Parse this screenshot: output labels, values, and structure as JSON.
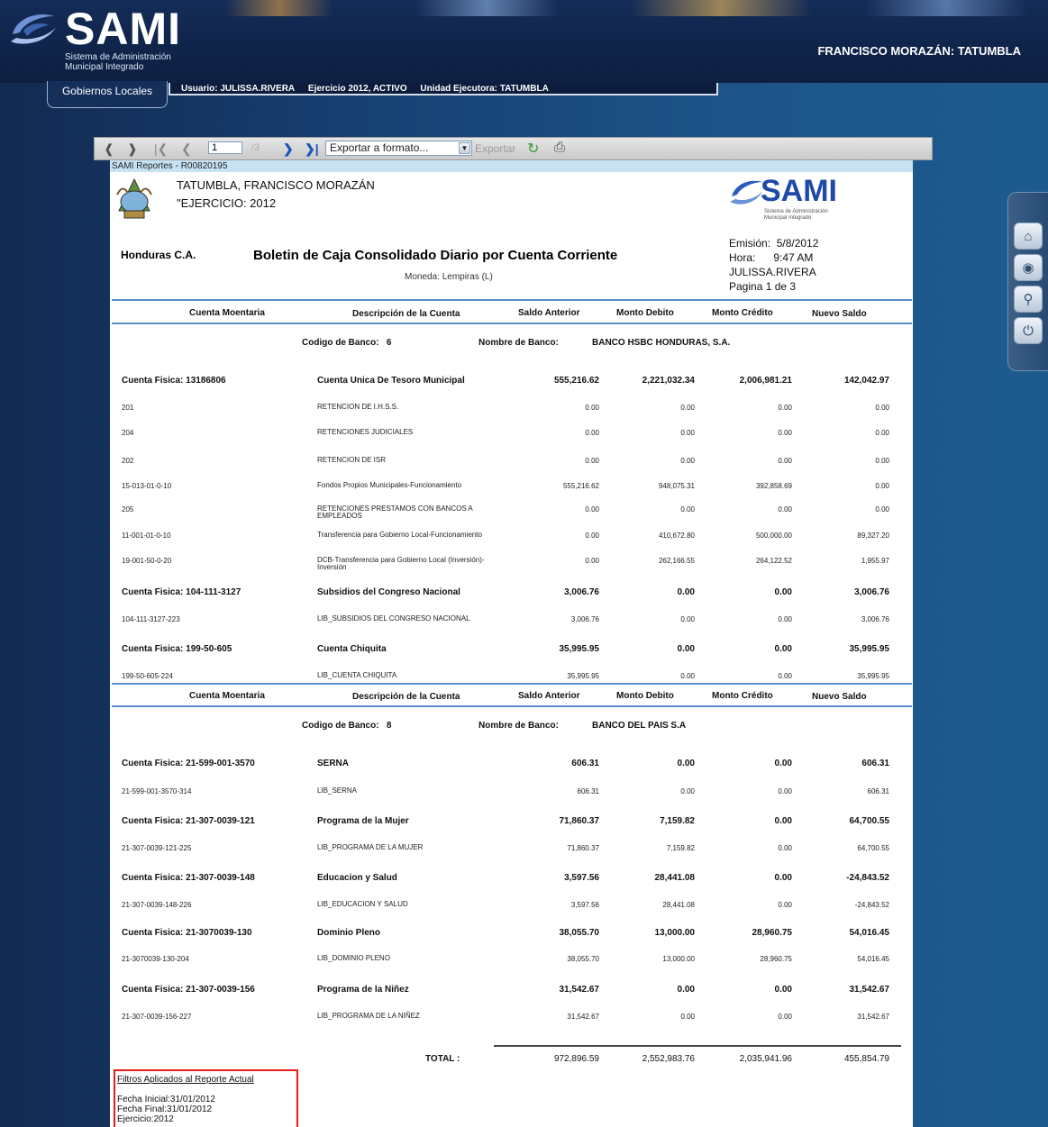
{
  "header": {
    "logo_text": "SAMI",
    "logo_sub1": "Sistema de Administración",
    "logo_sub2": "Municipal Integrado",
    "municipality": "FRANCISCO MORAZÁN: TATUMBLA"
  },
  "tabs": {
    "active_tab": "Gobiernos Locales",
    "user": "Usuario: JULISSA.RIVERA",
    "exercise": "Ejercicio 2012, ACTIVO",
    "unit": "Unidad Ejecutora: TATUMBLA"
  },
  "toolbar": {
    "page_value": "1",
    "page_total": "/3",
    "format_select": "Exportar a formato...",
    "export_label": "Exportar"
  },
  "sidepanel": {
    "icons": [
      "home-icon",
      "eye-icon",
      "key-icon",
      "power-icon"
    ]
  },
  "report": {
    "id": "SAMI Reportes - R00820195",
    "title1": "TATUMBLA, FRANCISCO MORAZÁN",
    "title2": "\"EJERCICIO: 2012",
    "sami_logo": "SAMI",
    "sami_sub1": "Sistema de Administración",
    "sami_sub2": "Municipal Integrado",
    "country": "Honduras C.A.",
    "report_title": "Boletin de Caja Consolidado Diario por Cuenta Corriente",
    "currency": "Moneda: Lempiras (L)",
    "emision_label": "Emisión:",
    "emision_value": "5/8/2012",
    "hora_label": "Hora:",
    "hora_value": "9:47 AM",
    "user": "JULISSA.RIVERA",
    "pagina": "Pagina 1 de 3",
    "columns": [
      "Cuenta Moentaria",
      "Descripción de la Cuenta",
      "Saldo Anterior",
      "Monto Debito",
      "Monto Crédito",
      "Nuevo Saldo"
    ],
    "bank1": {
      "code_label": "Codigo de Banco:",
      "code": "6",
      "name_label": "Nombre de Banco:",
      "name": "BANCO HSBC HONDURAS, S.A."
    },
    "bank1_rows": [
      {
        "type": "main",
        "c1": "Cuenta Fisica:  13186806",
        "c2": "Cuenta Unica De Tesoro Municipal",
        "c3": "555,216.62",
        "c4": "2,221,032.34",
        "c5": "2,006,981.21",
        "c6": "142,042.97"
      },
      {
        "type": "sub",
        "c1": "201",
        "c2": "RETENCION DE I.H.S.S.",
        "c3": "0.00",
        "c4": "0.00",
        "c5": "0.00",
        "c6": "0.00"
      },
      {
        "type": "sub",
        "c1": "204",
        "c2": "RETENCIONES JUDICIALES",
        "c3": "0.00",
        "c4": "0.00",
        "c5": "0.00",
        "c6": "0.00"
      },
      {
        "type": "sub",
        "c1": "202",
        "c2": "RETENCION DE ISR",
        "c3": "0.00",
        "c4": "0.00",
        "c5": "0.00",
        "c6": "0.00"
      },
      {
        "type": "sub",
        "c1": "15-013-01-0-10",
        "c2": "Fondos Propios Municipales-Funcionamiento",
        "c3": "555,216.62",
        "c4": "948,075.31",
        "c5": "392,858.69",
        "c6": "0.00"
      },
      {
        "type": "sub",
        "c1": "205",
        "c2": "RETENCIONES PRESTAMOS CON BANCOS A EMPLEADOS",
        "c3": "0.00",
        "c4": "0.00",
        "c5": "0.00",
        "c6": "0.00"
      },
      {
        "type": "sub",
        "c1": "11-001-01-0-10",
        "c2": "Transferencia para Gobierno Local-Funcionamiento",
        "c3": "0.00",
        "c4": "410,672.80",
        "c5": "500,000.00",
        "c6": "89,327.20"
      },
      {
        "type": "sub",
        "c1": "19-001-50-0-20",
        "c2": "DCB-Transferencia para Gobierno Local (Inversión)-Inversión",
        "c3": "0.00",
        "c4": "262,166.55",
        "c5": "264,122.52",
        "c6": "1,955.97"
      },
      {
        "type": "main",
        "c1": "Cuenta Fisica:  104-111-3127",
        "c2": "Subsidios del Congreso Nacional",
        "c3": "3,006.76",
        "c4": "0.00",
        "c5": "0.00",
        "c6": "3,006.76"
      },
      {
        "type": "sub",
        "c1": "104-111-3127-223",
        "c2": "LIB_SUBSIDIOS DEL CONGRESO NACIONAL",
        "c3": "3,006.76",
        "c4": "0.00",
        "c5": "0.00",
        "c6": "3,006.76"
      },
      {
        "type": "main",
        "c1": "Cuenta Fisica:  199-50-605",
        "c2": "Cuenta Chiquita",
        "c3": "35,995.95",
        "c4": "0.00",
        "c5": "0.00",
        "c6": "35,995.95"
      },
      {
        "type": "sub",
        "c1": "199-50-605-224",
        "c2": "LIB_CUENTA CHIQUITA",
        "c3": "35,995.95",
        "c4": "0.00",
        "c5": "0.00",
        "c6": "35,995.95"
      }
    ],
    "bank2": {
      "code_label": "Codigo de Banco:",
      "code": "8",
      "name_label": "Nombre de Banco:",
      "name": "BANCO DEL PAIS S.A"
    },
    "bank2_rows": [
      {
        "type": "main",
        "c1": "Cuenta Fisica:  21-599-001-3570",
        "c2": "SERNA",
        "c3": "606.31",
        "c4": "0.00",
        "c5": "0.00",
        "c6": "606.31"
      },
      {
        "type": "sub",
        "c1": "21-599-001-3570-314",
        "c2": "LIB_SERNA",
        "c3": "606.31",
        "c4": "0.00",
        "c5": "0.00",
        "c6": "606.31"
      },
      {
        "type": "main",
        "c1": "Cuenta Fisica:  21-307-0039-121",
        "c2": "Programa de la Mujer",
        "c3": "71,860.37",
        "c4": "7,159.82",
        "c5": "0.00",
        "c6": "64,700.55"
      },
      {
        "type": "sub",
        "c1": "21-307-0039-121-225",
        "c2": "LIB_PROGRAMA DE LA MUJER",
        "c3": "71,860.37",
        "c4": "7,159.82",
        "c5": "0.00",
        "c6": "64,700.55"
      },
      {
        "type": "main",
        "c1": "Cuenta Fisica:  21-307-0039-148",
        "c2": "Educacion y Salud",
        "c3": "3,597.56",
        "c4": "28,441.08",
        "c5": "0.00",
        "c6": "-24,843.52"
      },
      {
        "type": "sub",
        "c1": "21-307-0039-148-226",
        "c2": "LIB_EDUCACION Y SALUD",
        "c3": "3,597.56",
        "c4": "28,441.08",
        "c5": "0.00",
        "c6": "-24,843.52"
      },
      {
        "type": "main",
        "c1": "Cuenta Fisica:  21-3070039-130",
        "c2": "Dominio Pleno",
        "c3": "38,055.70",
        "c4": "13,000.00",
        "c5": "28,960.75",
        "c6": "54,016.45"
      },
      {
        "type": "sub",
        "c1": "21-3070039-130-204",
        "c2": "LIB_DOMINIO PLENO",
        "c3": "38,055.70",
        "c4": "13,000.00",
        "c5": "28,960.75",
        "c6": "54,016.45"
      },
      {
        "type": "main",
        "c1": "Cuenta Fisica:  21-307-0039-156",
        "c2": "Programa de la Niñez",
        "c3": "31,542.67",
        "c4": "0.00",
        "c5": "0.00",
        "c6": "31,542.67"
      },
      {
        "type": "sub",
        "c1": "21-307-0039-156-227",
        "c2": "LIB_PROGRAMA DE LA NIÑEZ",
        "c3": "31,542.67",
        "c4": "0.00",
        "c5": "0.00",
        "c6": "31,542.67"
      }
    ],
    "total": {
      "label": "TOTAL :",
      "c3": "972,896.59",
      "c4": "2,552,983.76",
      "c5": "2,035,941.96",
      "c6": "455,854.79"
    },
    "filters": {
      "title": "Filtros Aplicados al Reporte Actual",
      "fecha_inicial": "Fecha Inicial:31/01/2012",
      "fecha_final": "Fecha Final:31/01/2012",
      "ejercicio": "Ejercicio:2012"
    }
  }
}
